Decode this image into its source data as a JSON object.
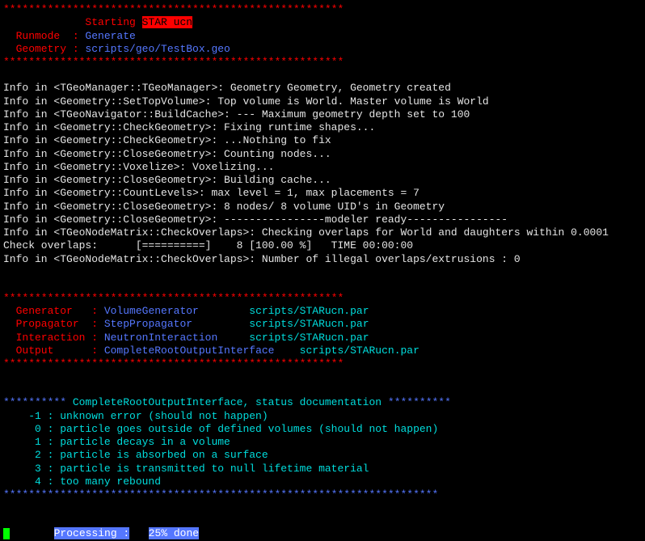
{
  "asterisks_long": "******************************************************",
  "starting_label": "             Starting ",
  "star_ucn": "STAR ucn",
  "runmode_label": "  Runmode  :",
  "runmode_value": " Generate",
  "geometry_label": "  Geometry :",
  "geometry_value": " scripts/geo/TestBox.geo",
  "info_lines": [
    "Info in <TGeoManager::TGeoManager>: Geometry Geometry, Geometry created",
    "Info in <Geometry::SetTopVolume>: Top volume is World. Master volume is World",
    "Info in <TGeoNavigator::BuildCache>: --- Maximum geometry depth set to 100",
    "Info in <Geometry::CheckGeometry>: Fixing runtime shapes...",
    "Info in <Geometry::CheckGeometry>: ...Nothing to fix",
    "Info in <Geometry::CloseGeometry>: Counting nodes...",
    "Info in <Geometry::Voxelize>: Voxelizing...",
    "Info in <Geometry::CloseGeometry>: Building cache...",
    "Info in <Geometry::CountLevels>: max level = 1, max placements = 7",
    "Info in <Geometry::CloseGeometry>: 8 nodes/ 8 volume UID's in Geometry",
    "Info in <Geometry::CloseGeometry>: ----------------modeler ready----------------",
    "Info in <TGeoNodeMatrix::CheckOverlaps>: Checking overlaps for World and daughters within 0.0001",
    "Check overlaps:      [==========]    8 [100.00 %]   TIME 00:00:00",
    "Info in <TGeoNodeMatrix::CheckOverlaps>: Number of illegal overlaps/extrusions : 0"
  ],
  "generator_label": "  Generator   :",
  "generator_value": " VolumeGenerator        ",
  "generator_path": "scripts/STARucn.par",
  "propagator_label": "  Propagator  :",
  "propagator_value": " StepPropagator         ",
  "propagator_path": "scripts/STARucn.par",
  "interaction_label": "  Interaction :",
  "interaction_value": " NeutronInteraction     ",
  "interaction_path": "scripts/STARucn.par",
  "output_label": "  Output      :",
  "output_value": " CompleteRootOutputInterface    ",
  "output_path": "scripts/STARucn.par",
  "status_asterisks_prefix": "**********",
  "status_heading": " CompleteRootOutputInterface, status documentation ",
  "status_asterisks_suffix": "**********",
  "status_lines": [
    "    -1 : unknown error (should not happen)",
    "     0 : particle goes outside of defined volumes (should not happen)",
    "     1 : particle decays in a volume",
    "     2 : particle is absorbed on a surface",
    "     3 : particle is transmitted to null lifetime material",
    "     4 : too many rebound"
  ],
  "asterisks_full": "*********************************************************************",
  "processing_prefix": "       ",
  "processing_label": "Processing :",
  "processing_gap": "   ",
  "processing_value": "25% done"
}
